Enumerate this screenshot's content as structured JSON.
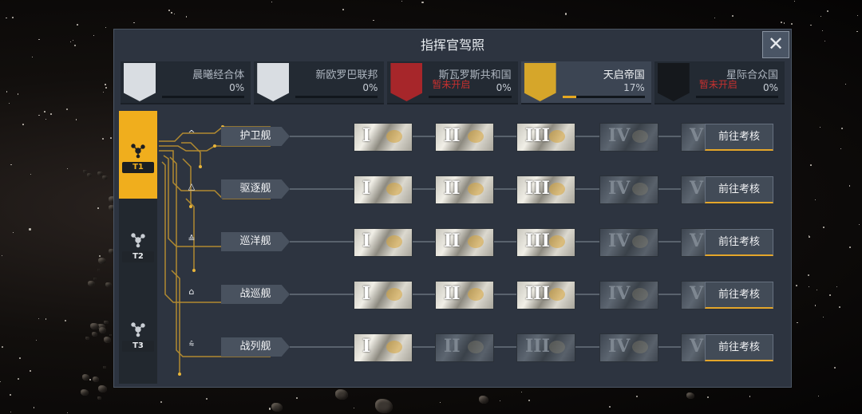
{
  "window": {
    "title": "指挥官驾照",
    "close_icon": "close-icon"
  },
  "factions": [
    {
      "name": "晨曦经合体",
      "percent": "0%",
      "progress": 0,
      "locked_text": "",
      "emblem": "blue-ring-emblem",
      "active": false
    },
    {
      "name": "新欧罗巴联邦",
      "percent": "0%",
      "progress": 0,
      "locked_text": "",
      "emblem": "cross-emblem",
      "active": false
    },
    {
      "name": "斯瓦罗斯共和国",
      "percent": "0%",
      "progress": 0,
      "locked_text": "暂未开启",
      "emblem": "red-star-emblem",
      "active": false
    },
    {
      "name": "天启帝国",
      "percent": "17%",
      "progress": 0.17,
      "locked_text": "",
      "emblem": "gold-circles-emblem",
      "active": true
    },
    {
      "name": "星际合众国",
      "percent": "0%",
      "progress": 0,
      "locked_text": "暂未开启",
      "emblem": "dark-hex-emblem",
      "active": false
    }
  ],
  "tiers": [
    {
      "label": "T1",
      "active": true
    },
    {
      "label": "T2",
      "active": false
    },
    {
      "label": "T3",
      "active": false
    }
  ],
  "ships": [
    {
      "name": "护卫舰",
      "rank_icon": "^",
      "unlocked_levels": 3,
      "button": "前往考核"
    },
    {
      "name": "驱逐舰",
      "rank_icon": "△",
      "unlocked_levels": 3,
      "button": "前往考核"
    },
    {
      "name": "巡洋舰",
      "rank_icon": "≙",
      "unlocked_levels": 3,
      "button": "前往考核"
    },
    {
      "name": "战巡舰",
      "rank_icon": "⌂",
      "unlocked_levels": 3,
      "button": "前往考核"
    },
    {
      "name": "战列舰",
      "rank_icon": "⩯",
      "unlocked_levels": 1,
      "button": "前往考核"
    }
  ],
  "levels": [
    "I",
    "II",
    "III",
    "IV",
    "V"
  ],
  "colors": {
    "accent": "#f0ae1d",
    "panel": "#2d3440",
    "locked_text": "#c7302f"
  }
}
